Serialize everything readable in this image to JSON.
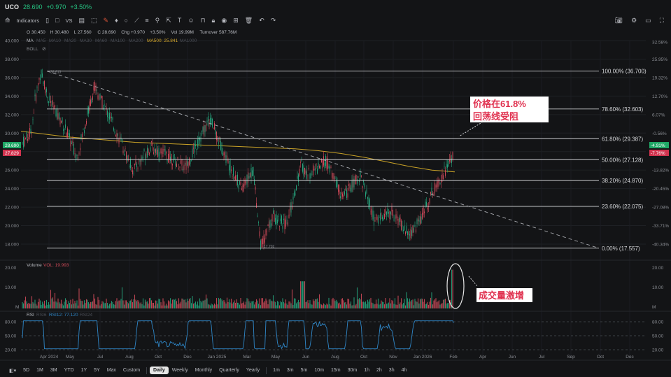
{
  "header": {
    "ticker": "UCO",
    "price": "28.690",
    "change": "+0.970",
    "pct": "+3.50%"
  },
  "toolbar": {
    "indicators_label": "Indicators",
    "vs_label": "VS"
  },
  "ohlc": {
    "o_label": "O",
    "o": "30.450",
    "h_label": "H",
    "h": "30.480",
    "l_label": "L",
    "l": "27.560",
    "c_label": "C",
    "c": "28.690",
    "chg_label": "Chg",
    "chg": "+0.970",
    "pct": "+3.50%",
    "vol_label": "Vol",
    "vol": "19.99M",
    "turnover_label": "Turnover",
    "turnover": "587.76M"
  },
  "ma_legend": {
    "title": "MA",
    "items": [
      "MA5",
      "MA10",
      "MA20",
      "MA30",
      "MA60",
      "MA100",
      "MA200"
    ],
    "active_label": "MA500:",
    "active_value": "25.841",
    "last": "MA1000",
    "active_color": "#d4a72c"
  },
  "boll_label": "BOLL",
  "volume_legend": {
    "title": "Volume",
    "vol_label": "VOL:",
    "vol_value": "19.993"
  },
  "rsi_legend": {
    "title": "RSI",
    "rsi6": "RSI6",
    "rsi12_label": "RSI12:",
    "rsi12_value": "77.120",
    "rsi24": "RSI24"
  },
  "annotations": {
    "resist": "价格在61.8% 回荡线受阻",
    "volume": "成交量激增"
  },
  "timeframes": [
    "5D",
    "1M",
    "3M",
    "YTD",
    "1Y",
    "5Y",
    "Max",
    "Custom",
    "Daily",
    "Weekly",
    "Monthly",
    "Quarterly",
    "Yearly",
    "1m",
    "3m",
    "5m",
    "10m",
    "15m",
    "30m",
    "1h",
    "2h",
    "3h",
    "4h"
  ],
  "active_timeframe": "Daily",
  "colors": {
    "up": "#26a17b",
    "down": "#d04a5a",
    "ma500": "#c9a227",
    "rsi": "#2f87c8",
    "accent_green": "#26c281",
    "annotation": "#e0314f"
  },
  "chart_data": {
    "type": "candlestick",
    "price_axis": {
      "ticks": [
        "40.000",
        "38.000",
        "36.000",
        "34.000",
        "32.000",
        "30.000",
        "28.000",
        "26.000",
        "24.000",
        "22.000",
        "20.000",
        "18.000"
      ],
      "ylim": [
        17.0,
        40.0
      ]
    },
    "pct_axis": {
      "ticks": [
        "32.58%",
        "25.95%",
        "19.32%",
        "12.70%",
        "6.07%",
        "-0.56%",
        "-7.19%",
        "-13.82%",
        "-20.45%",
        "-27.08%",
        "-33.71%",
        "-40.34%"
      ]
    },
    "price_badges": [
      {
        "value": "28.690",
        "pct": "-4.91%",
        "color": "#1fa866"
      },
      {
        "value": "27.829",
        "pct": "-7.76%",
        "color": "#d0334e"
      }
    ],
    "x_ticks": [
      "Apr 2024",
      "May",
      "Jul",
      "Aug",
      "Oct",
      "Dec",
      "Jan 2025",
      "Mar",
      "May",
      "Jun",
      "Aug",
      "Oct",
      "Nov",
      "Jan 2026",
      "Feb",
      "Apr",
      "Jun",
      "Jul",
      "Sep",
      "Oct",
      "Dec"
    ],
    "fib_levels": [
      {
        "ratio": "100.00%",
        "price": 36.7,
        "label": "100.00% (36.700)"
      },
      {
        "ratio": "78.60%",
        "price": 32.603,
        "label": "78.60% (32.603)"
      },
      {
        "ratio": "61.80%",
        "price": 29.387,
        "label": "61.80% (29.387)"
      },
      {
        "ratio": "50.00%",
        "price": 27.128,
        "label": "50.00% (27.128)"
      },
      {
        "ratio": "38.20%",
        "price": 24.87,
        "label": "38.20% (24.870)"
      },
      {
        "ratio": "23.60%",
        "price": 22.075,
        "label": "23.60% (22.075)"
      },
      {
        "ratio": "0.00%",
        "price": 17.557,
        "label": "0.00% (17.557)"
      }
    ],
    "high_marker": "36.613",
    "low_marker": "17.702",
    "ma500_series": [
      30.2,
      29.9,
      29.6,
      29.4,
      29.2,
      29.0,
      28.9,
      28.8,
      28.7,
      28.6,
      28.5,
      28.4,
      28.3,
      28.1,
      27.8,
      27.4,
      26.9,
      26.4,
      26.0,
      25.8
    ],
    "volume_axis": {
      "ticks": [
        "20.00",
        "10.00",
        "M"
      ]
    },
    "rsi_axis": {
      "ticks": [
        "80.00",
        "50.00",
        "20.00"
      ]
    }
  }
}
